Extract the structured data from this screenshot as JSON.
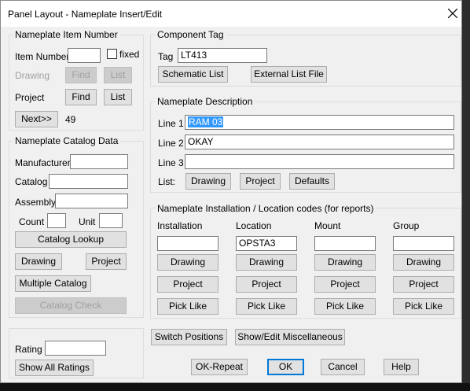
{
  "window": {
    "title": "Panel Layout - Nameplate Insert/Edit"
  },
  "item_number": {
    "group_label": "Nameplate Item Number",
    "item_number_label": "Item Number",
    "item_number_value": "",
    "fixed_label": "fixed",
    "fixed_checked": false,
    "drawing_label": "Drawing",
    "drawing_find": "Find",
    "drawing_list": "List",
    "project_label": "Project",
    "project_find": "Find",
    "project_list": "List",
    "next_label": "Next>>",
    "next_value": "49"
  },
  "catalog": {
    "group_label": "Nameplate Catalog Data",
    "manufacturer_label": "Manufacturer",
    "manufacturer_value": "",
    "catalog_label": "Catalog",
    "catalog_value": "",
    "assembly_label": "Assembly",
    "assembly_value": "",
    "count_label": "Count",
    "count_value": "",
    "unit_label": "Unit",
    "unit_value": "",
    "lookup_button": "Catalog Lookup",
    "drawing_button": "Drawing",
    "project_button": "Project",
    "multiple_button": "Multiple Catalog",
    "check_button": "Catalog Check"
  },
  "rating": {
    "label": "Rating",
    "value": "",
    "show_all_button": "Show All Ratings"
  },
  "component_tag": {
    "group_label": "Component Tag",
    "tag_label": "Tag",
    "tag_value": "LT413",
    "schematic_button": "Schematic List",
    "external_button": "External List File"
  },
  "description": {
    "group_label": "Nameplate Description",
    "line1_label": "Line 1",
    "line1_value": "RAM 03",
    "line2_label": "Line 2",
    "line2_value": "OKAY",
    "line3_label": "Line 3",
    "line3_value": "",
    "list_label": "List:",
    "drawing_button": "Drawing",
    "project_button": "Project",
    "defaults_button": "Defaults"
  },
  "install": {
    "group_label": "Nameplate Installation / Location codes  (for reports)",
    "columns": [
      {
        "label": "Installation",
        "value": "",
        "drawing": "Drawing",
        "project": "Project",
        "pick": "Pick Like"
      },
      {
        "label": "Location",
        "value": "OPSTA3",
        "drawing": "Drawing",
        "project": "Project",
        "pick": "Pick Like"
      },
      {
        "label": "Mount",
        "value": "",
        "drawing": "Drawing",
        "project": "Project",
        "pick": "Pick Like"
      },
      {
        "label": "Group",
        "value": "",
        "drawing": "Drawing",
        "project": "Project",
        "pick": "Pick Like"
      }
    ]
  },
  "footer": {
    "switch_button": "Switch Positions",
    "misc_button": "Show/Edit Miscellaneous",
    "okrepeat_button": "OK-Repeat",
    "ok_button": "OK",
    "cancel_button": "Cancel",
    "help_button": "Help"
  },
  "colors": {
    "accent": "#0078d7",
    "selection": "#3399ff",
    "dialog_bg": "#f0f0f0"
  }
}
